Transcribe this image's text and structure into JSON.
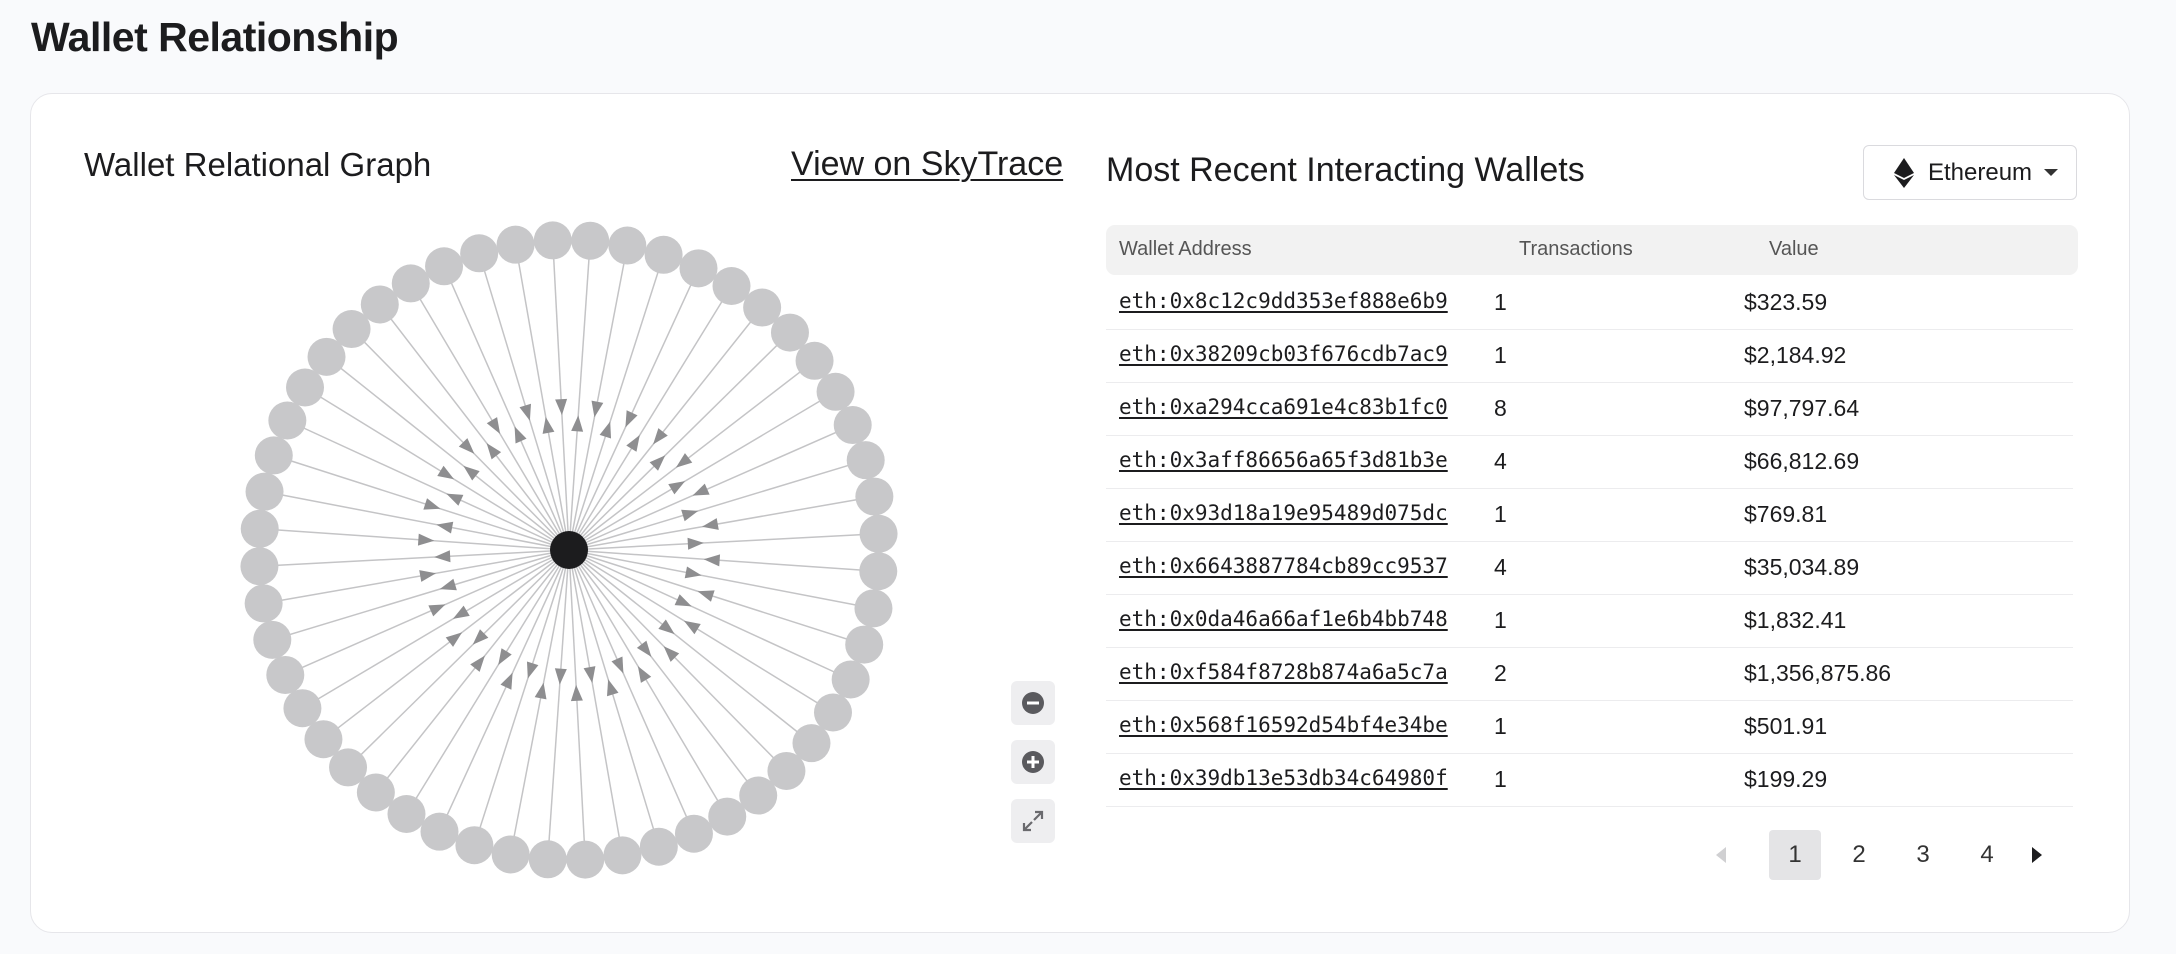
{
  "page": {
    "title": "Wallet Relationship"
  },
  "graph": {
    "title": "Wallet Relational Graph",
    "link_label": "View on SkyTrace",
    "node_count": 52,
    "colors": {
      "center": "#1c1c1e",
      "node": "#c8c8ca",
      "edge": "#c4c4c6",
      "arrow": "#8e8e90"
    }
  },
  "wallets": {
    "title": "Most Recent Interacting Wallets",
    "chain": {
      "label": "Ethereum",
      "icon": "ethereum-icon"
    },
    "columns": {
      "address": "Wallet Address",
      "transactions": "Transactions",
      "value": "Value"
    },
    "rows": [
      {
        "address": "eth:0x8c12c9dd353ef888e6b9",
        "transactions": "1",
        "value": "$323.59"
      },
      {
        "address": "eth:0x38209cb03f676cdb7ac9",
        "transactions": "1",
        "value": "$2,184.92"
      },
      {
        "address": "eth:0xa294cca691e4c83b1fc0",
        "transactions": "8",
        "value": "$97,797.64"
      },
      {
        "address": "eth:0x3aff86656a65f3d81b3e",
        "transactions": "4",
        "value": "$66,812.69"
      },
      {
        "address": "eth:0x93d18a19e95489d075dc",
        "transactions": "1",
        "value": "$769.81"
      },
      {
        "address": "eth:0x6643887784cb89cc9537",
        "transactions": "4",
        "value": "$35,034.89"
      },
      {
        "address": "eth:0x0da46a66af1e6b4bb748",
        "transactions": "1",
        "value": "$1,832.41"
      },
      {
        "address": "eth:0xf584f8728b874a6a5c7a",
        "transactions": "2",
        "value": "$1,356,875.86"
      },
      {
        "address": "eth:0x568f16592d54bf4e34be",
        "transactions": "1",
        "value": "$501.91"
      },
      {
        "address": "eth:0x39db13e53db34c64980f",
        "transactions": "1",
        "value": "$199.29"
      }
    ],
    "pagination": {
      "pages": [
        "1",
        "2",
        "3",
        "4"
      ],
      "current": "1"
    }
  }
}
